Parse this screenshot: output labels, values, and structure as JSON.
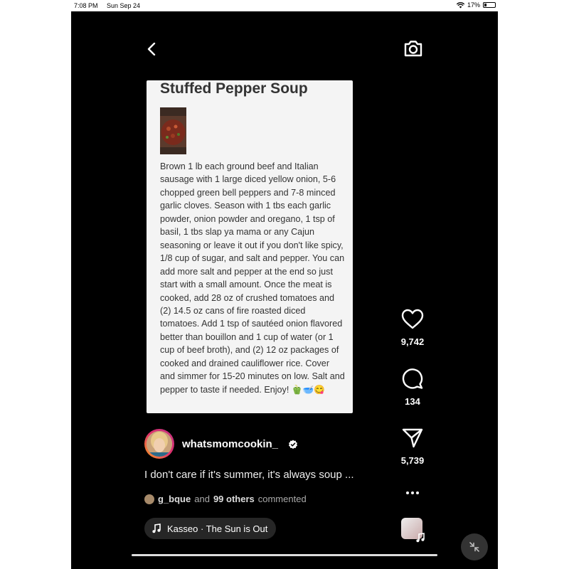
{
  "status_bar": {
    "time": "7:08 PM",
    "date": "Sun Sep 24",
    "battery": "17%"
  },
  "post": {
    "title": "Stuffed Pepper Soup",
    "recipe_text": "Brown 1 lb each ground beef and Italian sausage with 1 large diced yellow onion, 5-6 chopped green bell peppers and 7-8 minced garlic cloves. Season with 1 tbs each garlic powder, onion powder and oregano, 1 tsp of basil, 1 tbs slap ya mama or any Cajun seasoning or leave it out if you don't like spicy, 1/8 cup of sugar, and salt and pepper. You can add more salt and pepper at the end so just start with a small amount. Once the meat is cooked, add 28 oz of crushed tomatoes and (2) 14.5 oz cans of fire roasted diced tomatoes. Add 1 tsp of sautéed onion flavored better than bouillon and 1 cup of water (or 1 cup of beef broth), and (2) 12 oz packages of cooked and drained cauliflower rice. Cover and simmer for 15-20 minutes on low. Salt and pepper to taste if needed. Enjoy! 🫑🥣😋"
  },
  "actions": {
    "likes": "9,742",
    "comments": "134",
    "shares": "5,739"
  },
  "author": {
    "username": "whatsmomcookin_"
  },
  "caption": "I don't care if it's summer, it's always soup ...",
  "commenters": {
    "first": "g_bque",
    "joiner": "and",
    "others": "99 others",
    "suffix": "commented"
  },
  "music": {
    "label": "Kasseo · The Sun is Out"
  },
  "progress": {
    "fraction": 1.0
  },
  "icons": {
    "back": "chevron-left-icon",
    "camera": "camera-icon",
    "like": "heart-icon",
    "comment": "comment-icon",
    "share": "send-icon",
    "more": "more-icon",
    "verified": "verified-badge-icon",
    "music": "music-note-icon",
    "minimize": "minimize-icon"
  }
}
